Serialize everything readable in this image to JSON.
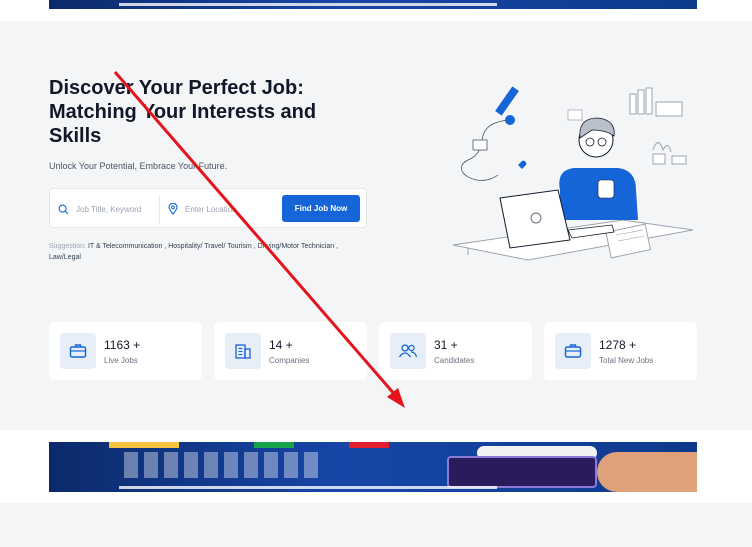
{
  "hero": {
    "headline": "Discover Your Perfect Job: Matching Your Interests and Skills",
    "subline": "Unlock Your Potential, Embrace Your Future."
  },
  "search": {
    "keyword_placeholder": "Job Title, Keyword",
    "location_placeholder": "Enter Location",
    "button_label": "Find Job Now"
  },
  "suggestion": {
    "prefix": "Suggestion:",
    "items": [
      "IT & Telecommunication ,",
      "Hospitality/ Travel/ Tourism ,",
      "Driving/Motor Technician ,",
      "Law/Legal"
    ]
  },
  "stats": [
    {
      "value": "1163 +",
      "label": "Live Jobs",
      "icon": "briefcase-icon"
    },
    {
      "value": "14 +",
      "label": "Companies",
      "icon": "building-icon"
    },
    {
      "value": "31 +",
      "label": "Candidates",
      "icon": "users-icon"
    },
    {
      "value": "1278 +",
      "label": "Total New Jobs",
      "icon": "briefcase-icon"
    }
  ],
  "colors": {
    "primary": "#1565d8",
    "hero_bg": "#f4f5f7",
    "annotation_arrow": "#e3141b"
  }
}
